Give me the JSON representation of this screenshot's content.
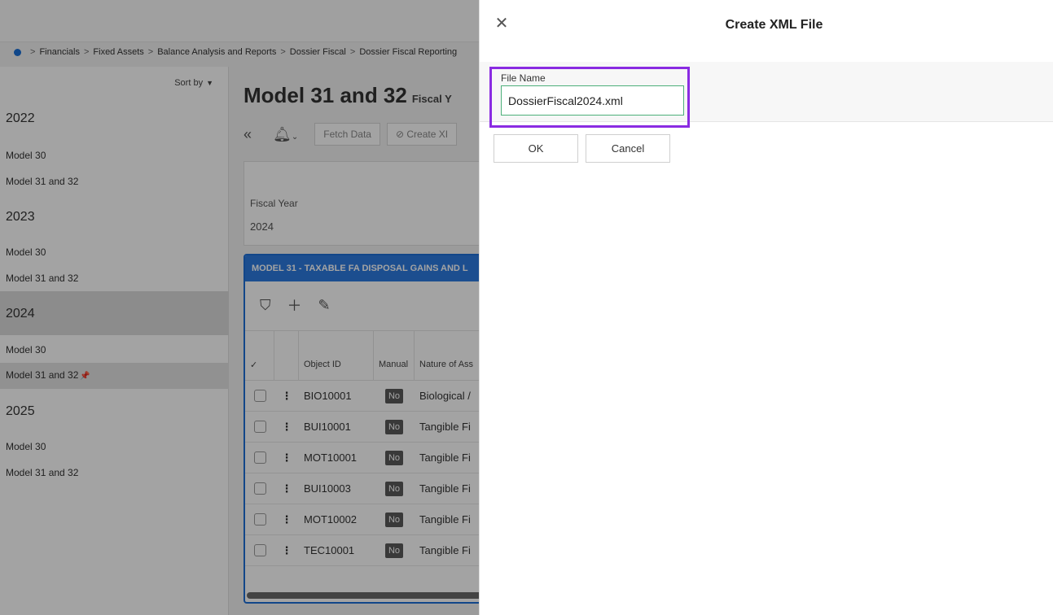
{
  "breadcrumb": [
    "Financials",
    "Fixed Assets",
    "Balance Analysis and Reports",
    "Dossier Fiscal",
    "Dossier Fiscal Reporting"
  ],
  "sidebar": {
    "sort_label": "Sort by",
    "groups": [
      {
        "year": "2022",
        "items": [
          "Model 30",
          "Model 31 and 32"
        ]
      },
      {
        "year": "2023",
        "items": [
          "Model 30",
          "Model 31 and 32"
        ]
      },
      {
        "year": "2024",
        "items": [
          "Model 30",
          "Model 31 and 32"
        ]
      },
      {
        "year": "2025",
        "items": [
          "Model 30",
          "Model 31 and 32"
        ]
      }
    ]
  },
  "main": {
    "title": "Model 31 and 32",
    "subtitle": "Fiscal Y",
    "toolbar": {
      "fetch_label": "Fetch Data",
      "create_label": "Create XI"
    },
    "fiscal_year_label": "Fiscal Year",
    "fiscal_year_value": "2024",
    "grid": {
      "title": "MODEL 31 - TAXABLE FA DISPOSAL GAINS AND L",
      "columns": [
        "Object ID",
        "Manual",
        "Nature of Ass"
      ],
      "rows": [
        {
          "id": "BIO10001",
          "manual": "No",
          "nature": "Biological /"
        },
        {
          "id": "BUI10001",
          "manual": "No",
          "nature": "Tangible Fi"
        },
        {
          "id": "MOT10001",
          "manual": "No",
          "nature": "Tangible Fi"
        },
        {
          "id": "BUI10003",
          "manual": "No",
          "nature": "Tangible Fi"
        },
        {
          "id": "MOT10002",
          "manual": "No",
          "nature": "Tangible Fi"
        },
        {
          "id": "TEC10001",
          "manual": "No",
          "nature": "Tangible Fi"
        }
      ]
    }
  },
  "dialog": {
    "title": "Create XML File",
    "close_icon": "close-icon",
    "field_label": "File Name",
    "field_value": "DossierFiscal2024.xml",
    "ok_label": "OK",
    "cancel_label": "Cancel",
    "highlight_color": "#8a2be2"
  }
}
